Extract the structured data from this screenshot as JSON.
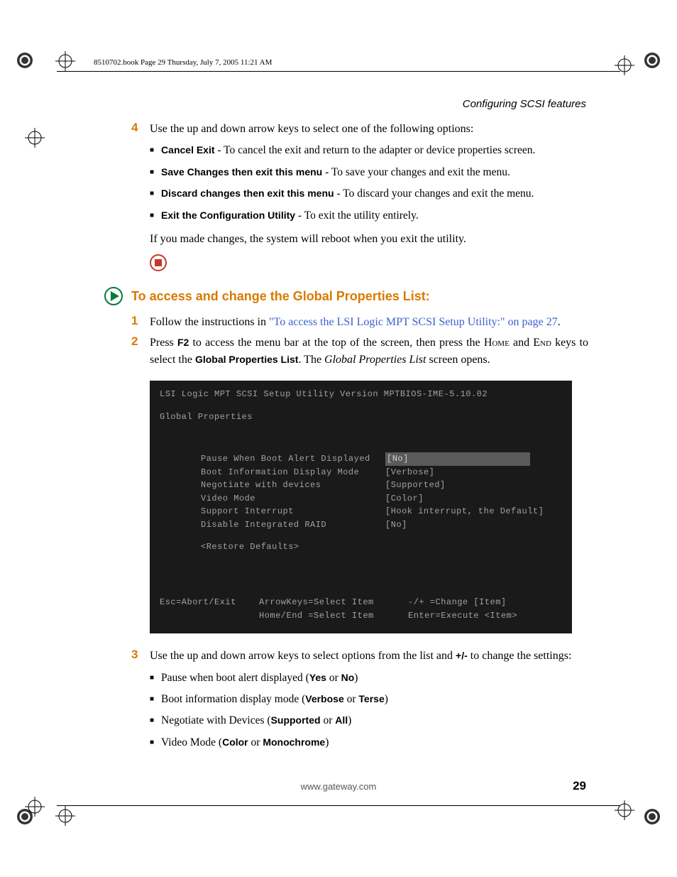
{
  "book_header": "8510702.book  Page 29  Thursday, July 7, 2005  11:21 AM",
  "section_heading": "Configuring SCSI features",
  "step4": {
    "num": "4",
    "intro": "Use the up and down arrow keys to select one of the following options:",
    "bullets": [
      {
        "bold": "Cancel Exit",
        "rest": " - To cancel the exit and return to the adapter or device properties screen."
      },
      {
        "bold": "Save Changes then exit this menu",
        "rest": " - To save your changes and exit the menu."
      },
      {
        "bold": "Discard changes then exit this menu",
        "rest": " - To discard your changes and exit the menu."
      },
      {
        "bold": "Exit the Configuration Utility",
        "rest": " - To exit the utility entirely."
      }
    ],
    "after": "If you made changes, the system will reboot when you exit the utility."
  },
  "subheading": "To access and change the Global Properties List:",
  "step1": {
    "num": "1",
    "pre": "Follow the instructions in ",
    "link": "\"To access the LSI Logic MPT SCSI Setup Utility:\" on page 27",
    "post": "."
  },
  "step2": {
    "num": "2",
    "text_a": "Press ",
    "f2": "F2",
    "text_b": " to access the menu bar at the top of the screen, then press the ",
    "home": "Home",
    "text_c": " and ",
    "end": "End",
    "text_d": " keys to select the ",
    "gpl_bold": "Global Properties List",
    "text_e": ". The ",
    "gpl_italic": "Global Properties List",
    "text_f": " screen opens."
  },
  "terminal": {
    "title": "LSI Logic MPT SCSI Setup Utility   Version  MPTBIOS-IME-5.10.02",
    "section": "Global Properties",
    "rows": [
      {
        "label": "Pause When Boot Alert Displayed",
        "value": "[No]",
        "hl": true
      },
      {
        "label": "Boot Information Display Mode",
        "value": "[Verbose]"
      },
      {
        "label": "Negotiate with devices",
        "value": "[Supported]"
      },
      {
        "label": "Video Mode",
        "value": "[Color]"
      },
      {
        "label": "Support Interrupt",
        "value": "[Hook interrupt, the Default]"
      },
      {
        "label": "Disable Integrated RAID",
        "value": "[No]"
      }
    ],
    "restore": "<Restore Defaults>",
    "footer": {
      "c1a": "Esc=Abort/Exit",
      "c2a": "ArrowKeys=Select Item",
      "c2b": "Home/End =Select Item",
      "c3a": "-/+  =Change [Item]",
      "c3b": "Enter=Execute <Item>"
    }
  },
  "step3": {
    "num": "3",
    "text_a": "Use the up and down arrow keys to select options from the list and ",
    "plusminus": "+/-",
    "text_b": " to change the settings:",
    "bullets": [
      {
        "pre": "Pause when boot alert displayed (",
        "b1": "Yes",
        "mid": " or ",
        "b2": "No",
        "post": ")"
      },
      {
        "pre": "Boot information display mode (",
        "b1": "Verbose",
        "mid": " or ",
        "b2": "Terse",
        "post": ")"
      },
      {
        "pre": "Negotiate with Devices (",
        "b1": "Supported",
        "mid": " or ",
        "b2": "All",
        "post": ")"
      },
      {
        "pre": "Video Mode (",
        "b1": "Color",
        "mid": " or ",
        "b2": "Monochrome",
        "post": ")"
      }
    ]
  },
  "footer_url": "www.gateway.com",
  "page_number": "29"
}
